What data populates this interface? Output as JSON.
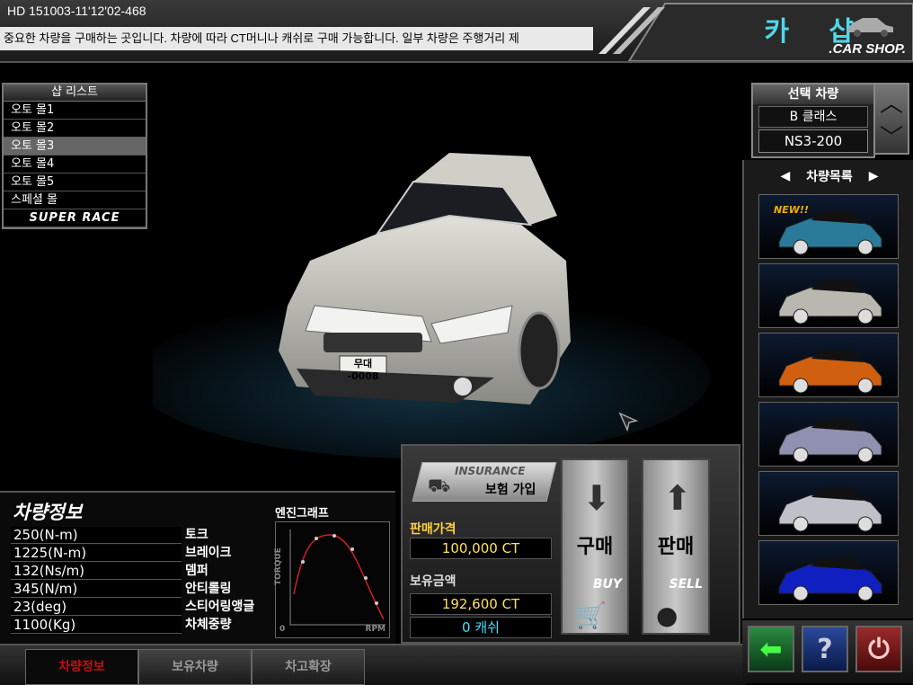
{
  "header": {
    "hd_code": "HD 151003-11'12'02-468",
    "ticker": "중요한 차량을 구매하는 곳입니다. 차량에 따라 CT머니나 캐쉬로 구매 가능합니다. 일부 차량은 주행거리 제",
    "logo_kr": "카 샵",
    "logo_en": ".CAR SHOP."
  },
  "shop_list": {
    "title": "샵 리스트",
    "items": [
      "오토 몰1",
      "오토 몰2",
      "오토 몰3",
      "오토 몰4",
      "오토 몰5",
      "스페셜 몰",
      "SUPER RACE"
    ],
    "selected_index": 2
  },
  "selected_car": {
    "title": "선택 차량",
    "class": "B 클래스",
    "model": "NS3-200"
  },
  "car_list": {
    "title": "차량목록",
    "new_label": "NEW!!",
    "colors": [
      "#2a7a9a",
      "#b8b8b0",
      "#d06010",
      "#9090b0",
      "#c0c0c8",
      "#1020c0"
    ]
  },
  "plate": {
    "line1": "무대",
    "line2": "-0008"
  },
  "vehicle_info": {
    "title": "차량정보",
    "rows": [
      {
        "value": "250(N-m)",
        "label": "토크"
      },
      {
        "value": "1225(N-m)",
        "label": "브레이크"
      },
      {
        "value": "132(Ns/m)",
        "label": "뎀퍼"
      },
      {
        "value": "345(N/m)",
        "label": "안티롤링"
      },
      {
        "value": "23(deg)",
        "label": "스티어링앵글"
      },
      {
        "value": "1100(Kg)",
        "label": "차체중량"
      }
    ],
    "engine_graph_title": "엔진그래프",
    "graph_y_label": "TORQUE",
    "graph_x_label": "RPM",
    "graph_origin": "0"
  },
  "price_panel": {
    "insurance_en": "INSURANCE",
    "insurance_kr": "보험 가입",
    "sale_price_label": "판매가격",
    "sale_price": "100,000 CT",
    "balance_label": "보유금액",
    "balance_ct": "192,600 CT",
    "balance_cash": "0 캐쉬",
    "buy_kr": "구매",
    "buy_en": "BUY",
    "sell_kr": "판매",
    "sell_en": "SELL"
  },
  "tabs": [
    "차량정보",
    "보유차량",
    "차고확장"
  ],
  "active_tab": 0
}
